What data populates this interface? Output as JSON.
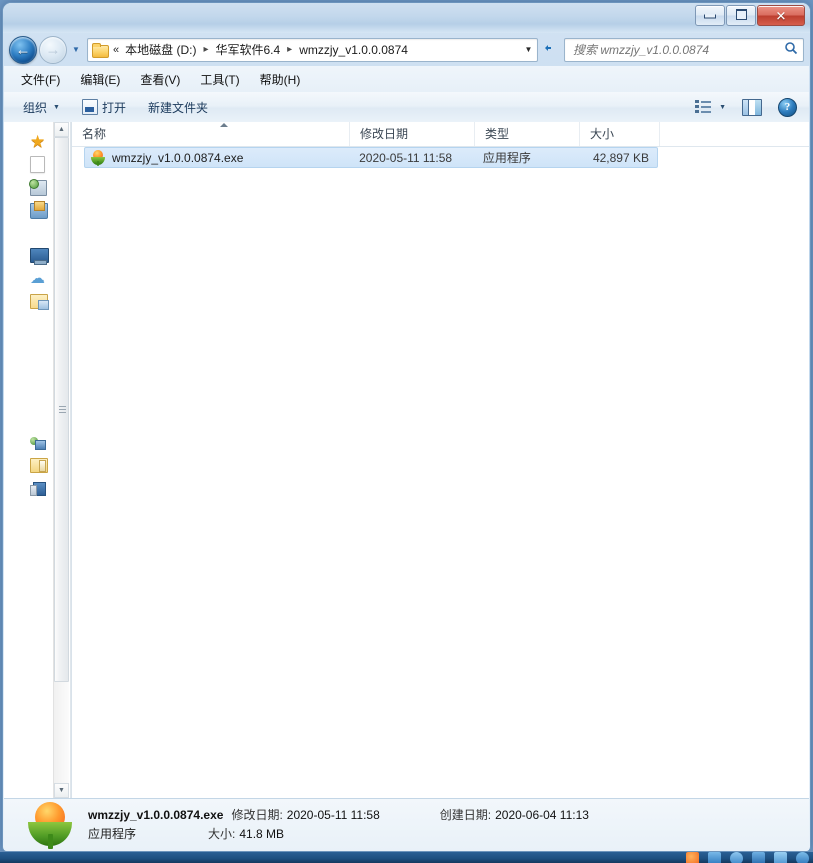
{
  "window": {
    "minimize_label": "最小化",
    "maximize_label": "最大化",
    "close_label": "✕"
  },
  "address": {
    "back_glyph": "←",
    "forward_glyph": "→",
    "double_chevron": "«",
    "separator": "▸",
    "crumbs": [
      "本地磁盘 (D:)",
      "华军软件6.4",
      "wmzzjy_v1.0.0.0874"
    ],
    "dropdown_glyph": "▼",
    "refresh_glyph": "↻"
  },
  "search": {
    "placeholder": "搜索 wmzzjy_v1.0.0.0874",
    "value": "",
    "icon_glyph": "⌕"
  },
  "menubar": {
    "items": [
      "文件(F)",
      "编辑(E)",
      "查看(V)",
      "工具(T)",
      "帮助(H)"
    ]
  },
  "toolbar": {
    "organize_label": "组织",
    "organize_caret": "▼",
    "open_label": "打开",
    "new_folder_label": "新建文件夹",
    "view_caret": "▼",
    "help_glyph": "?"
  },
  "navpane": {
    "icons": [
      "favorites-star-icon",
      "blank-document-icon",
      "recent-places-icon",
      "downloads-icon",
      "desktop-icon",
      "onedrive-cloud-icon",
      "libraries-folder-icon",
      "network-icon",
      "folder-icon",
      "computer-icon"
    ],
    "scroll_up_glyph": "▲",
    "scroll_down_glyph": "▼"
  },
  "columns": {
    "name": "名称",
    "date": "修改日期",
    "type": "类型",
    "size": "大小",
    "sort_direction": "ascending"
  },
  "files": [
    {
      "name": "wmzzjy_v1.0.0.0874.exe",
      "modified": "2020-05-11 11:58",
      "type": "应用程序",
      "size": "42,897 KB",
      "selected": true,
      "icon": "app-logo-icon"
    }
  ],
  "details": {
    "filename": "wmzzjy_v1.0.0.0874.exe",
    "modified_label": "修改日期:",
    "modified_value": "2020-05-11 11:58",
    "created_label": "创建日期:",
    "created_value": "2020-06-04 11:13",
    "type_value": "应用程序",
    "size_label": "大小:",
    "size_value": "41.8 MB",
    "icon": "app-logo-icon"
  },
  "taskbar": {
    "icons": [
      "browser-icon",
      "app-icon-1",
      "app-icon-2",
      "app-icon-3",
      "app-icon-4",
      "app-icon-5"
    ]
  },
  "colors": {
    "accent": "#2f7fc4",
    "selection": "#cfe4f8",
    "close_button": "#bd3f2f",
    "logo_orange": "#f0591f",
    "logo_green": "#4f9b25"
  }
}
